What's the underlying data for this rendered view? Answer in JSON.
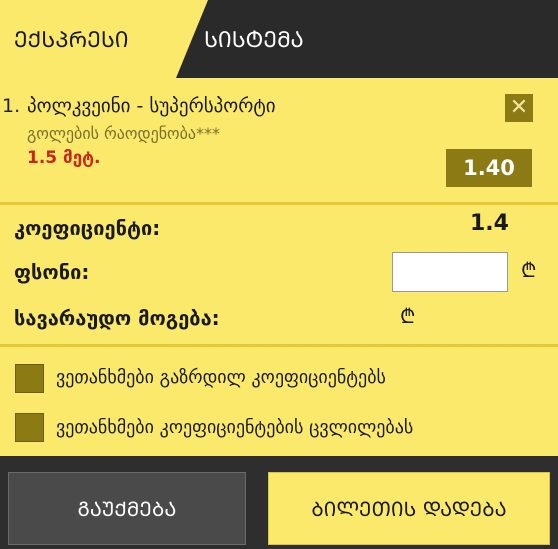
{
  "tabs": {
    "active": "ᲔᲥᲡᲞᲠᲔᲡᲘ",
    "inactive": "ᲡᲘᲡᲢᲔᲛᲐ"
  },
  "bet": {
    "number": "1.",
    "title": "პოლკვეინი - სუპერსპორტი",
    "market": "გოლების რაოდენობა***",
    "selection": "1.5 მეტ.",
    "odds": "1.40",
    "close_icon": "close-icon",
    "close_symbol": "✕"
  },
  "summary": {
    "coefficient_label": "კოეფიციენტი:",
    "coefficient_value": "1.4",
    "stake_label": "ფსონი:",
    "stake_value": "",
    "potential_win_label": "სავარაუდო მოგება:",
    "currency_symbol": "₾"
  },
  "options": [
    {
      "label": "ვეთანხმები გაზრდილ კოეფიციენტებს",
      "checked": true
    },
    {
      "label": "ვეთანხმები კოეფიციენტების ცვლილებას",
      "checked": true
    }
  ],
  "buttons": {
    "cancel": "ᲒᲐᲣᲥᲛᲔᲑᲐ",
    "place": "ᲑᲘᲚᲔᲗᲘᲡ ᲓᲐᲓᲔᲑᲐ"
  },
  "colors": {
    "accent": "#fae96a",
    "dark": "#2a2a2a",
    "checkbox": "#8c7a14",
    "selection": "#c8261a"
  }
}
